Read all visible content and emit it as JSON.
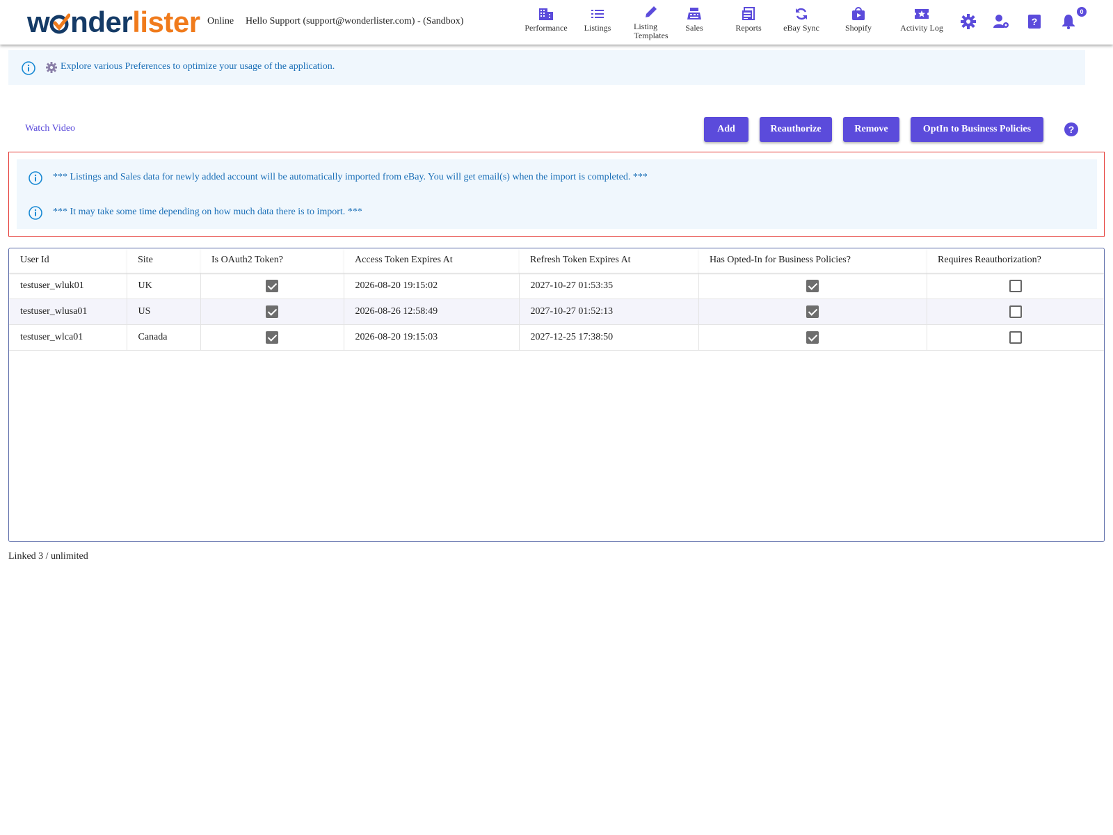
{
  "header": {
    "logo": {
      "part1": "w",
      "part2": "nder",
      "part3": "lister"
    },
    "status": "Online",
    "greeting": "Hello Support (support@wonderlister.com) - (Sandbox)",
    "nav": [
      {
        "label": "Performance",
        "icon": "building-icon"
      },
      {
        "label": "Listings",
        "icon": "list-icon"
      },
      {
        "label": "Listing Templates",
        "line1": "Listing",
        "line2": "Templates",
        "icon": "pencil-icon"
      },
      {
        "label": "Sales",
        "icon": "cash-register-icon"
      },
      {
        "label": "Reports",
        "icon": "reports-icon"
      },
      {
        "label": "eBay Sync",
        "icon": "sync-icon"
      },
      {
        "label": "Shopify",
        "icon": "shopify-bag-icon"
      },
      {
        "label": "Activity Log",
        "icon": "ticket-star-icon"
      }
    ],
    "notification_count": "0"
  },
  "info_banner": {
    "text": "Explore various Preferences to optimize your usage of the application."
  },
  "actions": {
    "watch_video": "Watch Video",
    "add": "Add",
    "reauthorize": "Reauthorize",
    "remove": "Remove",
    "optin": "OptIn to Business Policies"
  },
  "notices": [
    "*** Listings and Sales data for newly added account will be automatically imported from eBay. You will get email(s) when the import is completed. ***",
    "*** It may take some time depending on how much data there is to import. ***"
  ],
  "table": {
    "columns": [
      "User Id",
      "Site",
      "Is OAuth2 Token?",
      "Access Token Expires At",
      "Refresh Token Expires At",
      "Has Opted-In for Business Policies?",
      "Requires Reauthorization?"
    ],
    "rows": [
      {
        "user_id": "testuser_wluk01",
        "site": "UK",
        "oauth2": true,
        "access_expires": "2026-08-20 19:15:02",
        "refresh_expires": "2027-10-27 01:53:35",
        "opted_in": true,
        "requires_reauth": false
      },
      {
        "user_id": "testuser_wlusa01",
        "site": "US",
        "oauth2": true,
        "access_expires": "2026-08-26 12:58:49",
        "refresh_expires": "2027-10-27 01:52:13",
        "opted_in": true,
        "requires_reauth": false
      },
      {
        "user_id": "testuser_wlca01",
        "site": "Canada",
        "oauth2": true,
        "access_expires": "2026-08-20 19:15:03",
        "refresh_expires": "2027-12-25 17:38:50",
        "opted_in": true,
        "requires_reauth": false
      }
    ]
  },
  "footer": {
    "linked": "Linked 3 / unlimited"
  },
  "colors": {
    "accent": "#5b4bdb",
    "info_text": "#1a6fb7",
    "info_bg": "#f0f7fd",
    "notice_border": "#e53935",
    "logo_dark": "#143a66",
    "logo_orange": "#f07b1c"
  }
}
